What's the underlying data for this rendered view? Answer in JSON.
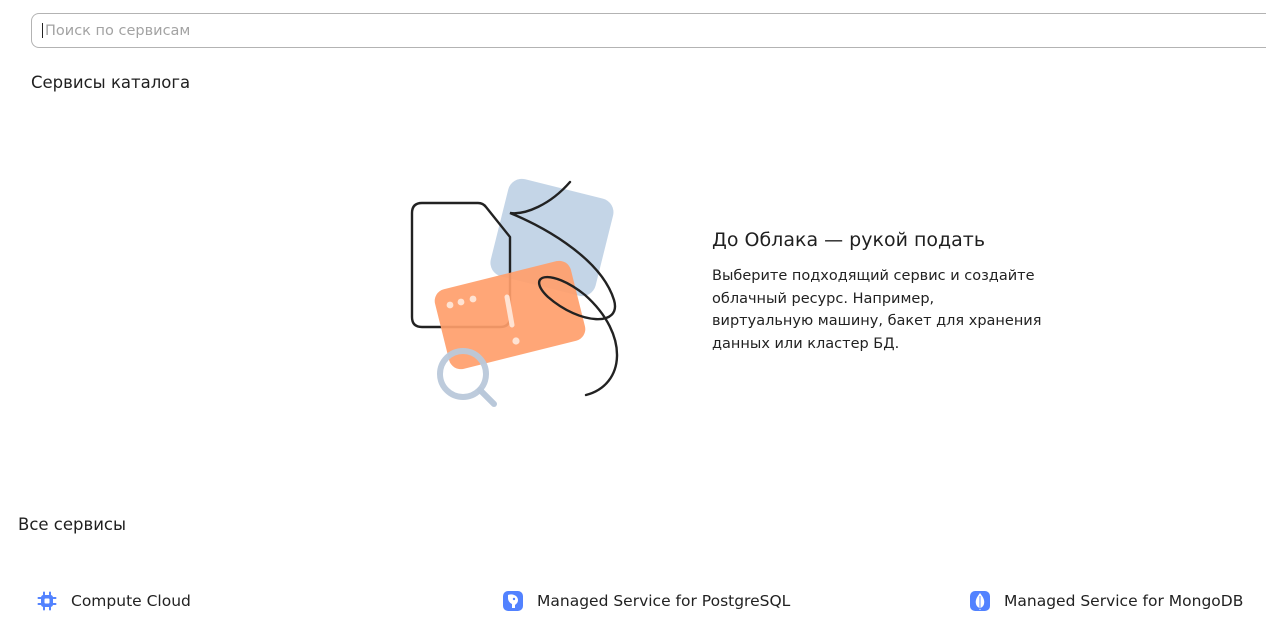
{
  "search": {
    "placeholder": "Поиск по сервисам",
    "value": ""
  },
  "catalog": {
    "title": "Сервисы каталога",
    "empty_state": {
      "heading": "До Облака — рукой подать",
      "description_lines": [
        "Выберите подходящий сервис и создайте",
        "облачный ресурс. Например,",
        "виртуальную машину, бакет для хранения",
        "данных или кластер БД."
      ]
    }
  },
  "all_services": {
    "title": "Все сервисы",
    "items": [
      {
        "label": "Compute Cloud",
        "icon": "compute-cloud-icon"
      },
      {
        "label": "Managed Service for PostgreSQL",
        "icon": "postgresql-icon"
      },
      {
        "label": "Managed Service for MongoDB",
        "icon": "mongodb-icon"
      }
    ]
  },
  "colors": {
    "accent_icon": "#5282ff",
    "illustration_orange": "#ff9e6b",
    "illustration_blue": "#c1d3e6"
  }
}
